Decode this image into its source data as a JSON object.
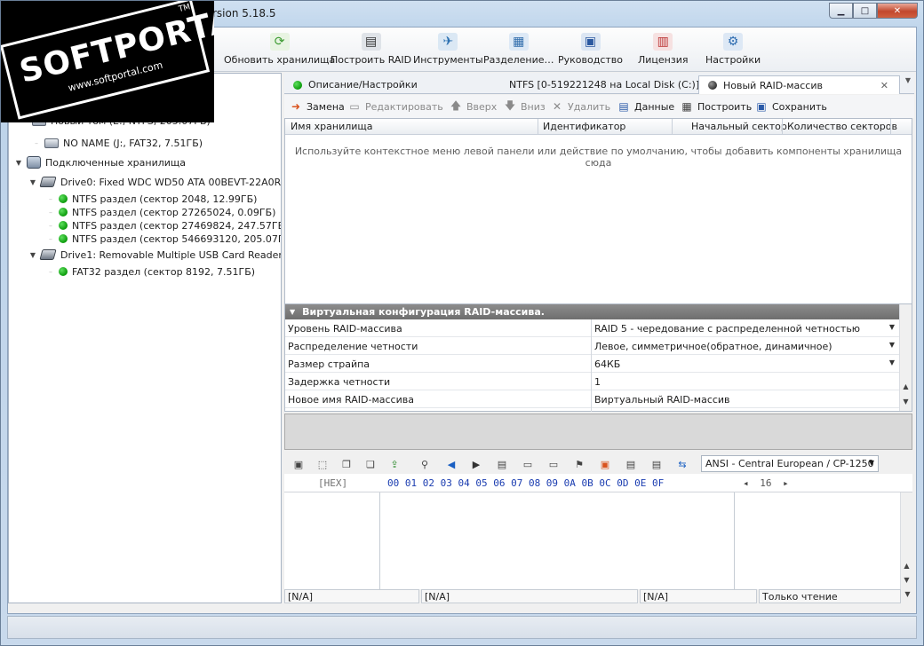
{
  "window": {
    "title": "rsion 5.18.5"
  },
  "logo": {
    "main": "SOFTPORTAL",
    "sub": "www.softportal.com",
    "tm": "TM"
  },
  "toolbar": {
    "buttons": [
      {
        "label": "Обновить хранилища",
        "icon": "refresh-icon"
      },
      {
        "label": "Построить RAID",
        "icon": "raid-icon"
      },
      {
        "label": "Инструменты",
        "icon": "tools-icon"
      },
      {
        "label": "Разделение…",
        "icon": "split-icon"
      },
      {
        "label": "Руководство",
        "icon": "manual-icon"
      },
      {
        "label": "Лицензия",
        "icon": "license-icon"
      },
      {
        "label": "Настройки",
        "icon": "settings-icon"
      }
    ]
  },
  "tree": {
    "partial_row": "Новый том (E:, NTFS, 205.07ГБ)",
    "noname": "NO NAME (J:, FAT32, 7.51ГБ)",
    "connected": "Подключенные хранилища",
    "drive0": "Drive0: Fixed WDC WD50 ATA 00BEVT-22A0R",
    "drive0_parts": [
      "NTFS раздел (сектор 2048, 12.99ГБ)",
      "NTFS раздел (сектор 27265024, 0.09ГБ)",
      "NTFS раздел (сектор 27469824, 247.57ГБ)",
      "NTFS раздел (сектор 546693120, 205.07ГБ)"
    ],
    "drive1": "Drive1: Removable Multiple USB Card  Reader",
    "drive1_parts": [
      "FAT32 раздел (сектор 8192, 7.51ГБ)"
    ]
  },
  "tabs": [
    {
      "label": "Описание/Настройки"
    },
    {
      "label": "NTFS [0-519221248 на Local Disk (C:)]"
    },
    {
      "label": "Новый RAID-массив"
    }
  ],
  "actions": {
    "replace": "Замена",
    "edit": "Редактировать",
    "up": "Вверх",
    "down": "Вниз",
    "delete": "Удалить",
    "data": "Данные",
    "build": "Построить",
    "save": "Сохранить"
  },
  "grid": {
    "columns": [
      "Имя хранилища",
      "Идентификатор",
      "Начальный сектор",
      "Количество секторов"
    ],
    "hint": "Используйте контекстное меню левой панели или действие по умолчанию, чтобы добавить компоненты хранилища сюда"
  },
  "props": {
    "header": "Виртуальная конфигурация RAID-массива.",
    "rows": [
      {
        "label": "Уровень RAID-массива",
        "value": "RAID 5 - чередование с распределенной четностью"
      },
      {
        "label": "Распределение четности",
        "value": "Левое, симметричное(обратное, динамичное)"
      },
      {
        "label": "Размер страйпа",
        "value": "64КБ"
      },
      {
        "label": "Задержка четности",
        "value": "1"
      },
      {
        "label": "Новое имя RAID-массива",
        "value": "Виртуальный RAID-массив"
      }
    ]
  },
  "hex": {
    "encoding": "ANSI - Central European / CP-1250",
    "label": "[HEX]",
    "columns": "00 01 02 03 04 05 06 07 08 09 0A 0B 0C 0D 0E 0F",
    "width": "16"
  },
  "status": {
    "s1": "[N/A]",
    "s2": "[N/A]",
    "s3": "[N/A]",
    "s4": "Только чтение"
  }
}
